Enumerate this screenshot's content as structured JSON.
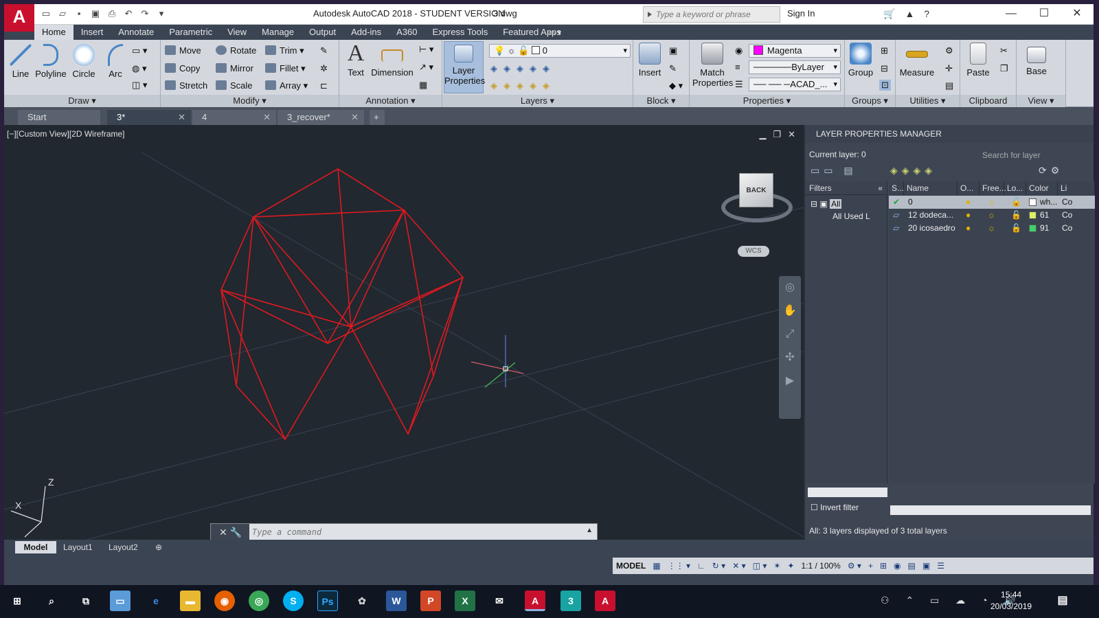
{
  "app": {
    "letter": "A",
    "title": "Autodesk AutoCAD 2018 - STUDENT VERSION",
    "file": "3.dwg"
  },
  "titlebar": {
    "search_placeholder": "Type a keyword or phrase",
    "sign_in": "Sign In"
  },
  "ribbon_tabs": [
    "Home",
    "Insert",
    "Annotate",
    "Parametric",
    "View",
    "Manage",
    "Output",
    "Add-ins",
    "A360",
    "Express Tools",
    "Featured Apps"
  ],
  "draw": {
    "title": "Draw",
    "line": "Line",
    "polyline": "Polyline",
    "circle": "Circle",
    "arc": "Arc"
  },
  "modify": {
    "title": "Modify",
    "move": "Move",
    "rotate": "Rotate",
    "trim": "Trim",
    "copy": "Copy",
    "mirror": "Mirror",
    "fillet": "Fillet",
    "stretch": "Stretch",
    "scale": "Scale",
    "array": "Array"
  },
  "annotation": {
    "title": "Annotation",
    "text": "Text",
    "dimension": "Dimension"
  },
  "layers": {
    "title": "Layers",
    "layer_properties_1": "Layer",
    "layer_properties_2": "Properties",
    "current": "0"
  },
  "block": {
    "title": "Block",
    "insert": "Insert"
  },
  "properties": {
    "title": "Properties",
    "match_1": "Match",
    "match_2": "Properties",
    "color": "Magenta",
    "lineweight": "ByLayer",
    "linetype": "ACAD_..."
  },
  "groups": {
    "title": "Groups",
    "group": "Group"
  },
  "utilities": {
    "title": "Utilities",
    "measure": "Measure"
  },
  "clipboard": {
    "title": "Clipboard",
    "paste": "Paste"
  },
  "view_panel": {
    "title": "View",
    "base": "Base"
  },
  "doc_tabs": [
    {
      "label": "Start"
    },
    {
      "label": "3*"
    },
    {
      "label": "4"
    },
    {
      "label": "3_recover*"
    }
  ],
  "viewport": {
    "label": "[−][Custom View][2D Wireframe]",
    "viewcube_face": "BACK",
    "wcs": "WCS",
    "axis_z": "Z",
    "axis_x": "X"
  },
  "command": {
    "placeholder": "Type a command"
  },
  "layer_manager": {
    "title": "LAYER PROPERTIES MANAGER",
    "current_layer": "Current layer: 0",
    "search_placeholder": "Search for layer",
    "filters_header": "Filters",
    "filter_all": "All",
    "filter_used": "All Used L",
    "invert_filter": "Invert filter",
    "columns": [
      "S...",
      "Name",
      "O...",
      "Free...",
      "Lo...",
      "Color",
      "Li"
    ],
    "rows": [
      {
        "name": "0",
        "color_label": "wh...",
        "color_hex": "#ffffff",
        "lt": "Co"
      },
      {
        "name": "12 dodeca...",
        "color_label": "61",
        "color_hex": "#d9f066",
        "lt": "Co"
      },
      {
        "name": "20 icosaedro",
        "color_label": "91",
        "color_hex": "#3fd06a",
        "lt": "Co"
      }
    ],
    "status": "All: 3 layers displayed of 3 total layers"
  },
  "layout_tabs": [
    "Model",
    "Layout1",
    "Layout2"
  ],
  "statusbar": {
    "model": "MODEL",
    "scale": "1:1 / 100%"
  },
  "taskbar": {
    "time": "15:44",
    "date": "20/03/2019"
  }
}
